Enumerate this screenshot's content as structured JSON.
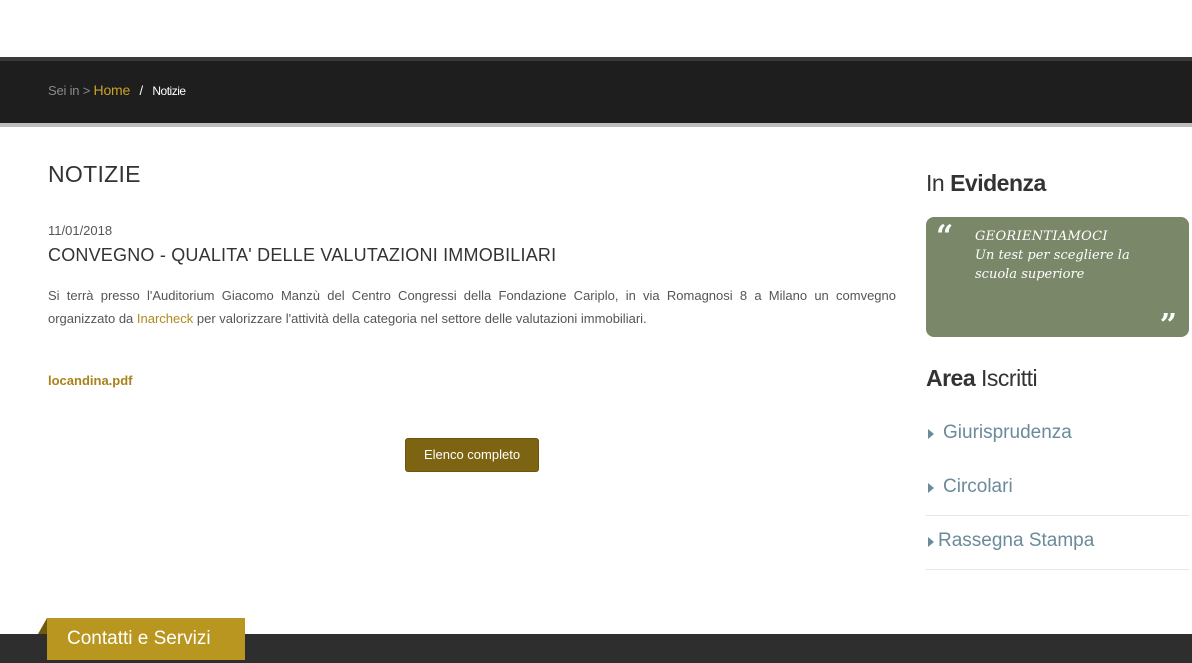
{
  "breadcrumb": {
    "prefix": "Sei in >",
    "home": "Home",
    "separator": "/",
    "current": "Notizie"
  },
  "main": {
    "page_title": "NOTIZIE",
    "article": {
      "date": "11/01/2018",
      "title": "CONVEGNO - QUALITA' DELLE VALUTAZIONI IMMOBILIARI",
      "body_before_link": "Si terrà presso l'Auditorium Giacomo Manzù del Centro Congressi della Fondazione Cariplo, in via Romagnosi 8 a Milano un comvegno organizzato da ",
      "link_text": "Inarcheck",
      "body_after_link": " per valorizzare l'attività della categoria nel settore delle valutazioni immobiliari.",
      "attachment": "locandina.pdf"
    },
    "full_list_button": "Elenco completo"
  },
  "sidebar": {
    "evidenza": {
      "heading_light": "In",
      "heading_bold": "Evidenza"
    },
    "quote": {
      "open_mark": "“",
      "close_mark": "”",
      "title": "GEORIENTIAMOCI",
      "text": "Un test per scegliere la scuola superiore"
    },
    "area": {
      "heading_bold": "Area",
      "heading_light": "Iscritti"
    },
    "links": [
      {
        "label": "Giurisprudenza"
      },
      {
        "label": "Circolari"
      },
      {
        "label": "Rassegna Stampa"
      }
    ]
  },
  "footer": {
    "tab_label": "Contatti e Servizi"
  },
  "colors": {
    "accent": "#c9a227",
    "button": "#7d6412",
    "quote_bg": "#7a8768",
    "link_blue": "#6b8a9a",
    "bar": "#1e1e1e",
    "footer": "#2e2e2e",
    "footer_tab": "#b8961f"
  }
}
